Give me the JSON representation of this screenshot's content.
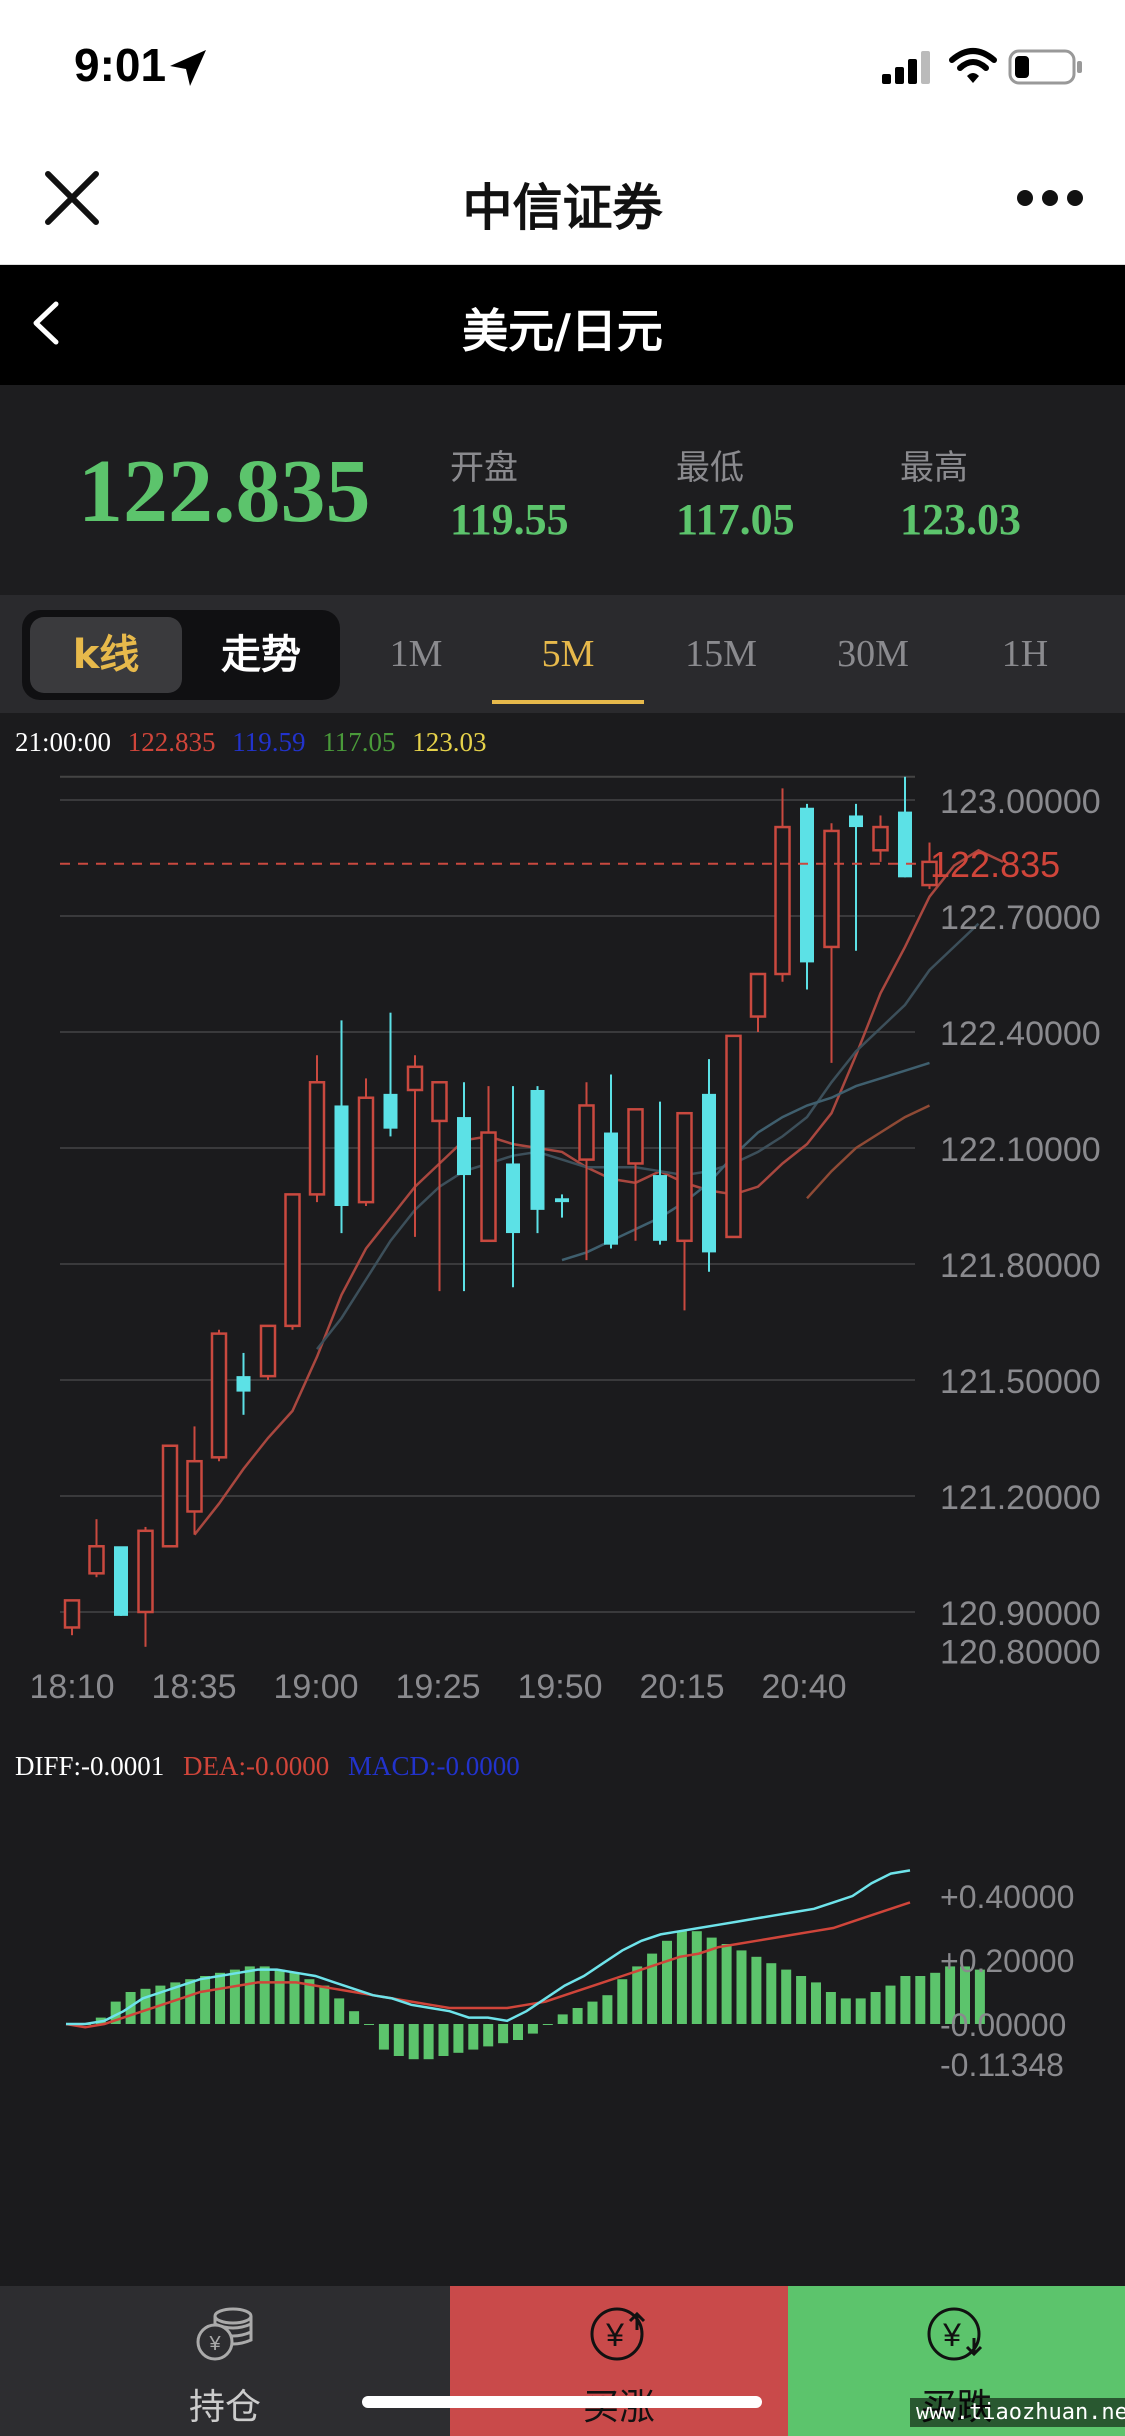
{
  "status": {
    "time": "9:01"
  },
  "app": {
    "title": "中信证券"
  },
  "pair": {
    "title": "美元/日元"
  },
  "quote": {
    "last": "122.835",
    "open_label": "开盘",
    "open": "119.55",
    "low_label": "最低",
    "low": "117.05",
    "high_label": "最高",
    "high": "123.03"
  },
  "tabs": {
    "k_label": "k线",
    "trend_label": "走势",
    "periods": [
      "1M",
      "5M",
      "15M",
      "30M",
      "1H"
    ],
    "active_period": "5M"
  },
  "info": {
    "time": "21:00:00",
    "v1": "122.835",
    "v2": "119.59",
    "v3": "117.05",
    "v4": "123.03"
  },
  "macd": {
    "diff": "DIFF:-0.0001",
    "dea": "DEA:-0.0000",
    "macd": "MACD:-0.0000"
  },
  "bottom": {
    "hold": "持仓",
    "buy_up": "买涨",
    "buy_down": "买跌"
  },
  "watermark": "www.tiaozhuan.net",
  "colors": {
    "up": "#c9493f",
    "down": "#5ce1e6",
    "green": "#5cc46c",
    "gold": "#e7b94b"
  },
  "chart_data": [
    {
      "type": "candlestick",
      "title": "",
      "current_price": 122.835,
      "ylim": [
        120.8,
        123.0
      ],
      "yticks": [
        "123.00000",
        "122.70000",
        "122.40000",
        "122.10000",
        "121.80000",
        "121.50000",
        "121.20000",
        "120.90000",
        "120.80000"
      ],
      "xticks": [
        "18:10",
        "18:35",
        "19:00",
        "19:25",
        "19:50",
        "20:15",
        "20:40"
      ],
      "candles": [
        {
          "o": 120.86,
          "h": 120.93,
          "l": 120.84,
          "c": 120.93
        },
        {
          "o": 121.0,
          "h": 121.14,
          "l": 120.99,
          "c": 121.07
        },
        {
          "o": 121.07,
          "h": 121.06,
          "l": 120.89,
          "c": 120.89
        },
        {
          "o": 120.9,
          "h": 121.12,
          "l": 120.81,
          "c": 121.11
        },
        {
          "o": 121.07,
          "h": 121.33,
          "l": 121.07,
          "c": 121.33
        },
        {
          "o": 121.16,
          "h": 121.38,
          "l": 121.1,
          "c": 121.29
        },
        {
          "o": 121.3,
          "h": 121.63,
          "l": 121.29,
          "c": 121.62
        },
        {
          "o": 121.51,
          "h": 121.57,
          "l": 121.41,
          "c": 121.47
        },
        {
          "o": 121.51,
          "h": 121.64,
          "l": 121.5,
          "c": 121.64
        },
        {
          "o": 121.64,
          "h": 121.98,
          "l": 121.63,
          "c": 121.98
        },
        {
          "o": 121.98,
          "h": 122.34,
          "l": 121.96,
          "c": 122.27
        },
        {
          "o": 122.21,
          "h": 122.43,
          "l": 121.88,
          "c": 121.95
        },
        {
          "o": 121.96,
          "h": 122.28,
          "l": 121.95,
          "c": 122.23
        },
        {
          "o": 122.24,
          "h": 122.45,
          "l": 122.13,
          "c": 122.15
        },
        {
          "o": 122.25,
          "h": 122.34,
          "l": 121.87,
          "c": 122.31
        },
        {
          "o": 122.17,
          "h": 122.25,
          "l": 121.73,
          "c": 122.27
        },
        {
          "o": 122.18,
          "h": 122.27,
          "l": 121.73,
          "c": 122.03
        },
        {
          "o": 121.86,
          "h": 122.26,
          "l": 121.86,
          "c": 122.14
        },
        {
          "o": 122.06,
          "h": 122.26,
          "l": 121.74,
          "c": 121.88
        },
        {
          "o": 122.25,
          "h": 122.26,
          "l": 121.88,
          "c": 121.94
        },
        {
          "o": 121.97,
          "h": 121.98,
          "l": 121.92,
          "c": 121.96
        },
        {
          "o": 122.07,
          "h": 122.27,
          "l": 121.81,
          "c": 122.21
        },
        {
          "o": 122.14,
          "h": 122.29,
          "l": 121.84,
          "c": 121.85
        },
        {
          "o": 122.06,
          "h": 122.2,
          "l": 121.86,
          "c": 122.2
        },
        {
          "o": 122.03,
          "h": 122.22,
          "l": 121.85,
          "c": 121.86
        },
        {
          "o": 121.86,
          "h": 122.19,
          "l": 121.68,
          "c": 122.19
        },
        {
          "o": 122.24,
          "h": 122.33,
          "l": 121.78,
          "c": 121.83
        },
        {
          "o": 121.87,
          "h": 122.39,
          "l": 121.87,
          "c": 122.39
        },
        {
          "o": 122.44,
          "h": 122.55,
          "l": 122.4,
          "c": 122.55
        },
        {
          "o": 122.55,
          "h": 123.03,
          "l": 122.53,
          "c": 122.93
        },
        {
          "o": 122.98,
          "h": 122.99,
          "l": 122.51,
          "c": 122.58
        },
        {
          "o": 122.62,
          "h": 122.94,
          "l": 122.32,
          "c": 122.92
        },
        {
          "o": 122.96,
          "h": 122.99,
          "l": 122.61,
          "c": 122.93
        },
        {
          "o": 122.87,
          "h": 122.96,
          "l": 122.84,
          "c": 122.93
        },
        {
          "o": 122.97,
          "h": 123.06,
          "l": 122.8,
          "c": 122.8
        },
        {
          "o": 122.78,
          "h": 122.89,
          "l": 122.77,
          "c": 122.84
        }
      ],
      "ma": [
        {
          "color": "#a9473f",
          "start": 5,
          "values": [
            121.1,
            121.18,
            121.27,
            121.35,
            121.42,
            121.56,
            121.72,
            121.84,
            121.92,
            122.0,
            122.06,
            122.12,
            122.13,
            122.11,
            122.1,
            122.09,
            122.05,
            122.02,
            122.01,
            122.04,
            122.01,
            121.99,
            121.98,
            122.0,
            122.06,
            122.11,
            122.19,
            122.34,
            122.5,
            122.62,
            122.75,
            122.83,
            122.87,
            122.84
          ]
        },
        {
          "color": "#3c4f5a",
          "start": 10,
          "values": [
            121.58,
            121.66,
            121.76,
            121.86,
            121.94,
            122.0,
            122.04,
            122.06,
            122.08,
            122.09,
            122.07,
            122.05,
            122.05,
            122.05,
            122.04,
            122.03,
            122.04,
            122.06,
            122.09,
            122.13,
            122.18,
            122.27,
            122.35,
            122.41,
            122.47,
            122.56,
            122.62,
            122.68
          ]
        },
        {
          "color": "#3f5f6e",
          "start": 20,
          "values": [
            121.81,
            121.83,
            121.86,
            121.89,
            121.92,
            121.96,
            122.01,
            122.08,
            122.14,
            122.18,
            122.21,
            122.23,
            122.26,
            122.28,
            122.3,
            122.32
          ]
        },
        {
          "color": "#8f4a35",
          "start": 30,
          "values": [
            121.97,
            122.04,
            122.1,
            122.14,
            122.18,
            122.21
          ]
        }
      ]
    },
    {
      "type": "macd",
      "ylim": [
        -0.11348,
        0.4
      ],
      "yticks": [
        "+0.40000",
        "+0.20000",
        "-0.00000",
        "-0.11348"
      ],
      "histogram": [
        0.0,
        0.0,
        0.02,
        0.07,
        0.1,
        0.11,
        0.12,
        0.13,
        0.14,
        0.15,
        0.16,
        0.17,
        0.18,
        0.18,
        0.17,
        0.16,
        0.14,
        0.12,
        0.08,
        0.04,
        0.0,
        -0.08,
        -0.1,
        -0.11,
        -0.11,
        -0.1,
        -0.09,
        -0.08,
        -0.07,
        -0.06,
        -0.05,
        -0.03,
        0.0,
        0.03,
        0.05,
        0.07,
        0.09,
        0.14,
        0.18,
        0.22,
        0.26,
        0.29,
        0.29,
        0.27,
        0.25,
        0.23,
        0.21,
        0.19,
        0.17,
        0.15,
        0.13,
        0.1,
        0.08,
        0.08,
        0.1,
        0.12,
        0.15,
        0.15,
        0.16,
        0.18,
        0.18,
        0.17
      ],
      "diff": [
        0.0,
        0.0,
        0.01,
        0.04,
        0.08,
        0.1,
        0.12,
        0.14,
        0.15,
        0.16,
        0.17,
        0.17,
        0.16,
        0.15,
        0.13,
        0.11,
        0.09,
        0.08,
        0.06,
        0.05,
        0.04,
        0.02,
        0.02,
        0.01,
        0.04,
        0.08,
        0.12,
        0.15,
        0.19,
        0.23,
        0.26,
        0.28,
        0.29,
        0.3,
        0.31,
        0.32,
        0.33,
        0.34,
        0.35,
        0.36,
        0.38,
        0.4,
        0.44,
        0.47,
        0.48
      ],
      "dea": [
        0.0,
        -0.01,
        0.0,
        0.02,
        0.04,
        0.06,
        0.08,
        0.1,
        0.11,
        0.12,
        0.13,
        0.13,
        0.13,
        0.12,
        0.11,
        0.1,
        0.09,
        0.08,
        0.07,
        0.06,
        0.05,
        0.05,
        0.05,
        0.05,
        0.06,
        0.07,
        0.09,
        0.11,
        0.13,
        0.15,
        0.17,
        0.19,
        0.21,
        0.22,
        0.24,
        0.25,
        0.26,
        0.27,
        0.28,
        0.29,
        0.3,
        0.32,
        0.34,
        0.36,
        0.38
      ]
    }
  ]
}
